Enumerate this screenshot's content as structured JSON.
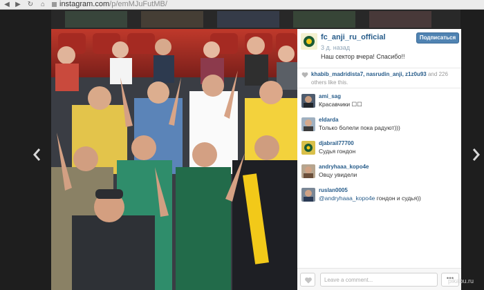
{
  "browser": {
    "url_host": "instagram.com",
    "url_path": "/p/emMJuFutMB/"
  },
  "post": {
    "username": "fc_anji_ru_official",
    "time_ago": "3 д. назад",
    "follow_label": "Подписаться",
    "caption": "Наш сектор вчера! Спасибо!!",
    "photo_alt_icon": "crowd-photo"
  },
  "likes": {
    "names": "khabib_madridista7, nasrudin_anji, z1z0u93",
    "and_word": "and",
    "count": "226",
    "others_text": "others like this."
  },
  "comments": [
    {
      "user": "ami_sag",
      "text": "Красавчики ☐☐",
      "mention": ""
    },
    {
      "user": "eldarda",
      "text": "Только болели пока радуют)))",
      "mention": ""
    },
    {
      "user": "djabrail77700",
      "text": "Судья гондон",
      "mention": ""
    },
    {
      "user": "andryhaaa_kopo4e",
      "text": "Овцу увидели",
      "mention": ""
    },
    {
      "user": "ruslan0005",
      "text": "гондон и судья))",
      "mention": "@andryhaaa_kopo4e"
    }
  ],
  "footer": {
    "comment_placeholder": "Leave a comment...",
    "more_label": "•••"
  },
  "watermark": "pikabu.ru",
  "colors": {
    "link": "#275c8a",
    "follow_button": "#5083b2",
    "page_background": "#1e1e1e"
  }
}
